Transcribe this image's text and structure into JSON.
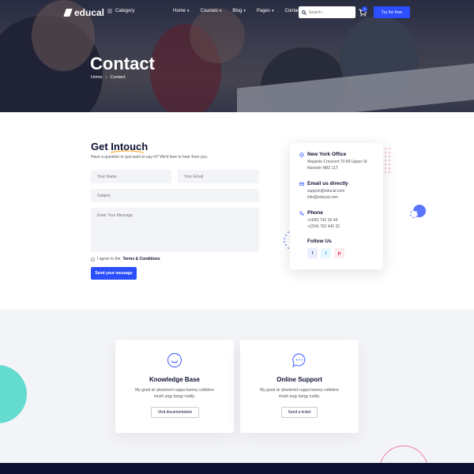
{
  "brand": {
    "name": "educal",
    "accent": "#2b4eff",
    "dark": "#0e1133"
  },
  "nav": {
    "category_label": "Category",
    "menu": [
      {
        "label": "Home",
        "has_dropdown": true
      },
      {
        "label": "Courses",
        "has_dropdown": true
      },
      {
        "label": "Blog",
        "has_dropdown": true
      },
      {
        "label": "Pages",
        "has_dropdown": true
      },
      {
        "label": "Contact",
        "has_dropdown": false
      }
    ],
    "search_placeholder": "Search...",
    "cart_count": "0",
    "try_button": "Try for free"
  },
  "hero": {
    "title": "Contact",
    "breadcrumb": [
      "Home",
      "Contact"
    ]
  },
  "contact_form": {
    "title": "Get Intouch",
    "intro": "Have a question or just want to say hi? We'd love to hear from you.",
    "name_placeholder": "Your Name",
    "email_placeholder": "Your Email",
    "subject_placeholder": "Subject",
    "message_placeholder": "Enter Your Message",
    "agree_prefix": "I agree to the",
    "agree_link": "Terms & Conditions",
    "send_button": "Send your message"
  },
  "info_card": {
    "office": {
      "title": "New York Office",
      "lines": [
        "Maypole Crescent 70-80 Upper St",
        "Norwich NR2 1LT"
      ]
    },
    "email": {
      "title": "Email us directly",
      "lines": [
        "support@educal.com",
        "info@educal.com"
      ]
    },
    "phone": {
      "title": "Phone",
      "lines": [
        "+(426) 742 26 44",
        "+(224) 762 442 32"
      ]
    },
    "follow_title": "Follow Us",
    "social": [
      "f",
      "t",
      "p"
    ]
  },
  "support": [
    {
      "title": "Knowledge Base",
      "text": "My good sir plastered cuppa barney cobblers mush argy bargy ruddy.",
      "button": "Visit documentation"
    },
    {
      "title": "Online Support",
      "text": "My good sir plastered cuppa barney cobblers mush argy bargy ruddy.",
      "button": "Send a ticket"
    }
  ]
}
